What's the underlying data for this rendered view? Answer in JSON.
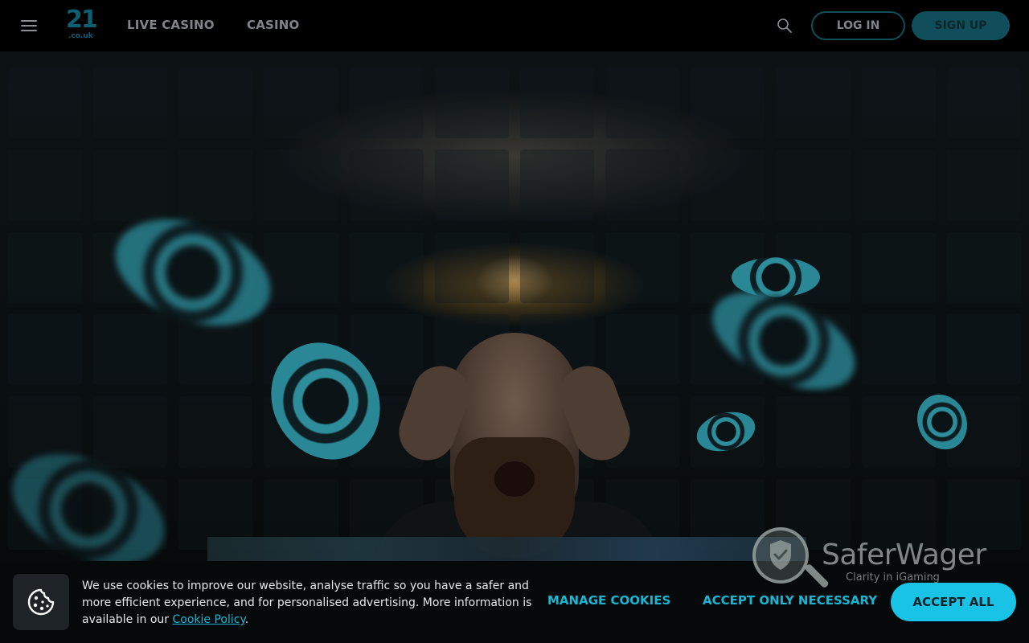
{
  "header": {
    "menu_icon": "hamburger-menu-icon",
    "logo": {
      "number": "21",
      "suffix": ".co.uk"
    },
    "nav": [
      {
        "label": "LIVE CASINO"
      },
      {
        "label": "CASINO"
      }
    ],
    "search_icon": "search-icon",
    "login_label": "LOG IN",
    "signup_label": "SIGN UP"
  },
  "hero": {
    "image_description_icon": "hero-banner"
  },
  "watermark": {
    "title": "SaferWager",
    "subtitle": "Clarity in iGaming",
    "icon": "shield-check-magnifier-icon"
  },
  "cookie_banner": {
    "icon": "cookie-icon",
    "text": "We use cookies to improve our website, analyse traffic so you have a safer and more efficient experience, and for personalised advertising. More information is available in our ",
    "link_label": "Cookie Policy",
    "text_end": ".",
    "manage_label": "MANAGE COOKIES",
    "necessary_label": "ACCEPT ONLY NECESSARY",
    "accept_all_label": "ACCEPT ALL"
  },
  "colors": {
    "accent": "#19c3e6",
    "header_bg": "#000000",
    "brand_teal": "#0f4e5a"
  }
}
